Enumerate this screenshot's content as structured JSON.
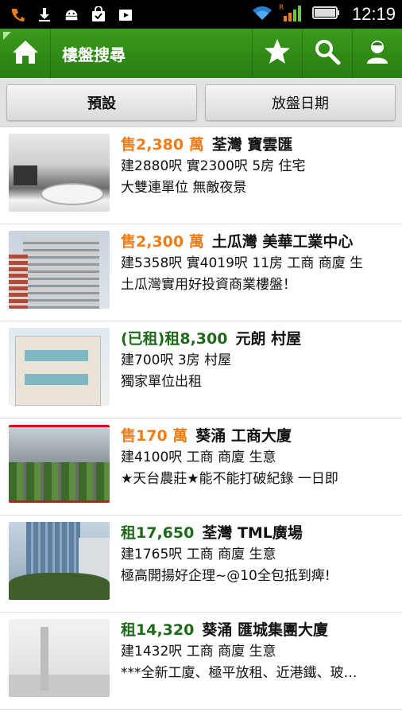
{
  "statusbar": {
    "time": "12:19"
  },
  "actionbar": {
    "title": "樓盤搜尋",
    "icons": [
      "home-icon",
      "star-icon",
      "search-icon",
      "user-icon"
    ],
    "color": "#2f8a16"
  },
  "sort": {
    "default_label": "預設",
    "date_label": "放盤日期"
  },
  "listings": [
    {
      "price": "售2,380 萬",
      "type": "sale",
      "location": "荃灣 寶雲匯",
      "details": "建2880呎 實2300呎 5房 住宅",
      "description": "大雙連單位 無敵夜景"
    },
    {
      "price": "售2,300 萬",
      "type": "sale",
      "location": "土瓜灣 美華工業中心",
      "details": "建5358呎 實4019呎 11房 工商 商廈 生",
      "description": "土瓜灣實用好投資商業樓盤！"
    },
    {
      "price": "(已租)租8,300",
      "type": "rent",
      "location": "元朗 村屋",
      "details": "建700呎 3房 村屋",
      "description": "獨家單位出租"
    },
    {
      "price": "售170 萬",
      "type": "sale",
      "location": "葵涌 工商大廈",
      "details": "建4100呎 工商 商廈 生意",
      "description": "★天台農莊★能不能打破紀錄 一日即"
    },
    {
      "price": "租17,650",
      "type": "rent",
      "location": "荃灣 TML廣場",
      "details": "建1765呎 工商 商廈 生意",
      "description": "極高開揚好企理~@10全包抵到痺!"
    },
    {
      "price": "租14,320",
      "type": "rent",
      "location": "葵涌 匯城集團大廈",
      "details": "建1432呎 工商 商廈 生意",
      "description": "***全新工廈、極平放租、近港鐵、玻…"
    }
  ]
}
